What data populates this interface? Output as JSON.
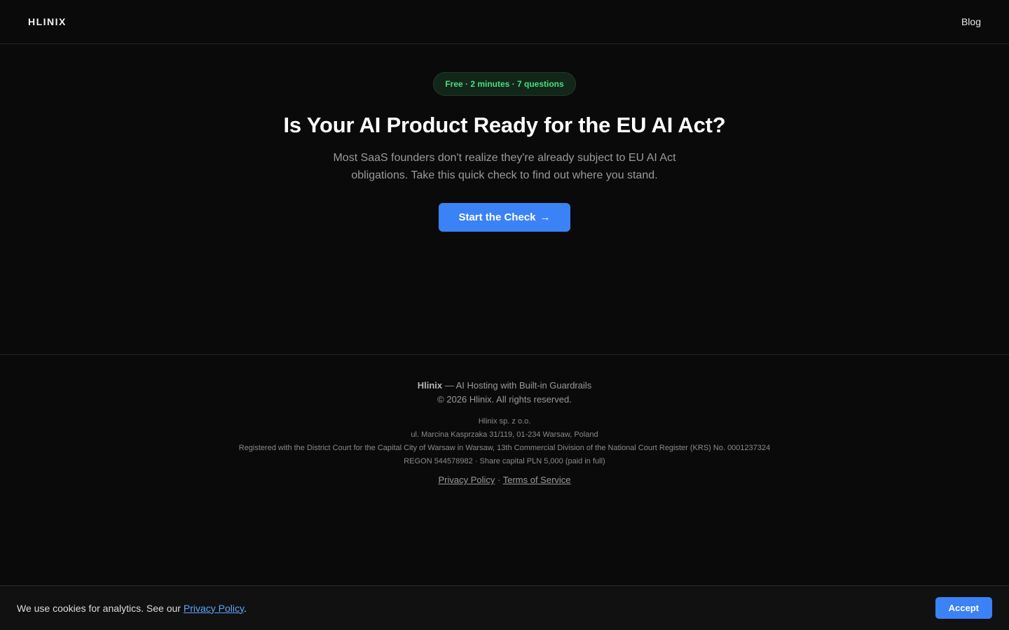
{
  "header": {
    "logo": "HLINIX",
    "nav_blog": "Blog"
  },
  "hero": {
    "badge": "Free · 2 minutes · 7 questions",
    "title": "Is Your AI Product Ready for the EU AI Act?",
    "subtitle": "Most SaaS founders don't realize they're already subject to EU AI Act obligations. Take this quick check to find out where you stand.",
    "cta_label": "Start the Check",
    "cta_arrow": "→"
  },
  "footer": {
    "brand": "Hlinix",
    "tagline": " — AI Hosting with Built-in Guardrails",
    "copyright": "© 2026 Hlinix. All rights reserved.",
    "company": "Hlinix sp. z o.o.",
    "address": "ul. Marcina Kasprzaka 31/119, 01-234 Warsaw, Poland",
    "registration": "Registered with the District Court for the Capital City of Warsaw in Warsaw, 13th Commercial Division of the National Court Register (KRS) No. 0001237324",
    "regon": "REGON 544578982 · Share capital PLN 5,000 (paid in full)",
    "privacy_link": "Privacy Policy",
    "link_separator": " · ",
    "terms_link": "Terms of Service"
  },
  "cookie_banner": {
    "text": "We use cookies for analytics. See our ",
    "link": "Privacy Policy",
    "suffix": ".",
    "accept_label": "Accept"
  },
  "colors": {
    "accent": "#3b82f6",
    "badge_text": "#4ade80",
    "background": "#0a0a0a"
  }
}
